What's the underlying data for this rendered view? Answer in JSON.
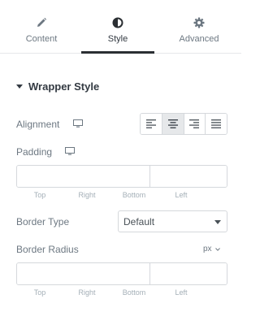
{
  "tabs": [
    {
      "label": "Content",
      "icon": "pencil-icon"
    },
    {
      "label": "Style",
      "icon": "half-circle-icon",
      "active": true
    },
    {
      "label": "Advanced",
      "icon": "gear-icon"
    }
  ],
  "section": {
    "title": "Wrapper Style"
  },
  "alignment": {
    "label": "Alignment",
    "options": [
      "align-left-icon",
      "align-center-icon",
      "align-right-icon",
      "align-justify-icon"
    ],
    "selected": "center"
  },
  "padding": {
    "label": "Padding",
    "top": "",
    "right": "",
    "bottom": "",
    "left": "",
    "sublabels": [
      "Top",
      "Right",
      "Bottom",
      "Left"
    ]
  },
  "border_type": {
    "label": "Border Type",
    "value": "Default"
  },
  "border_radius": {
    "label": "Border Radius",
    "unit": "px",
    "top": "",
    "right": "",
    "bottom": "",
    "left": "",
    "sublabels": [
      "Top",
      "Right",
      "Bottom",
      "Left"
    ]
  },
  "colors": {
    "accent": "#2b2f33",
    "border": "#d5d8dc",
    "text": "#6d7882",
    "active_bg": "#e6e8ea"
  }
}
